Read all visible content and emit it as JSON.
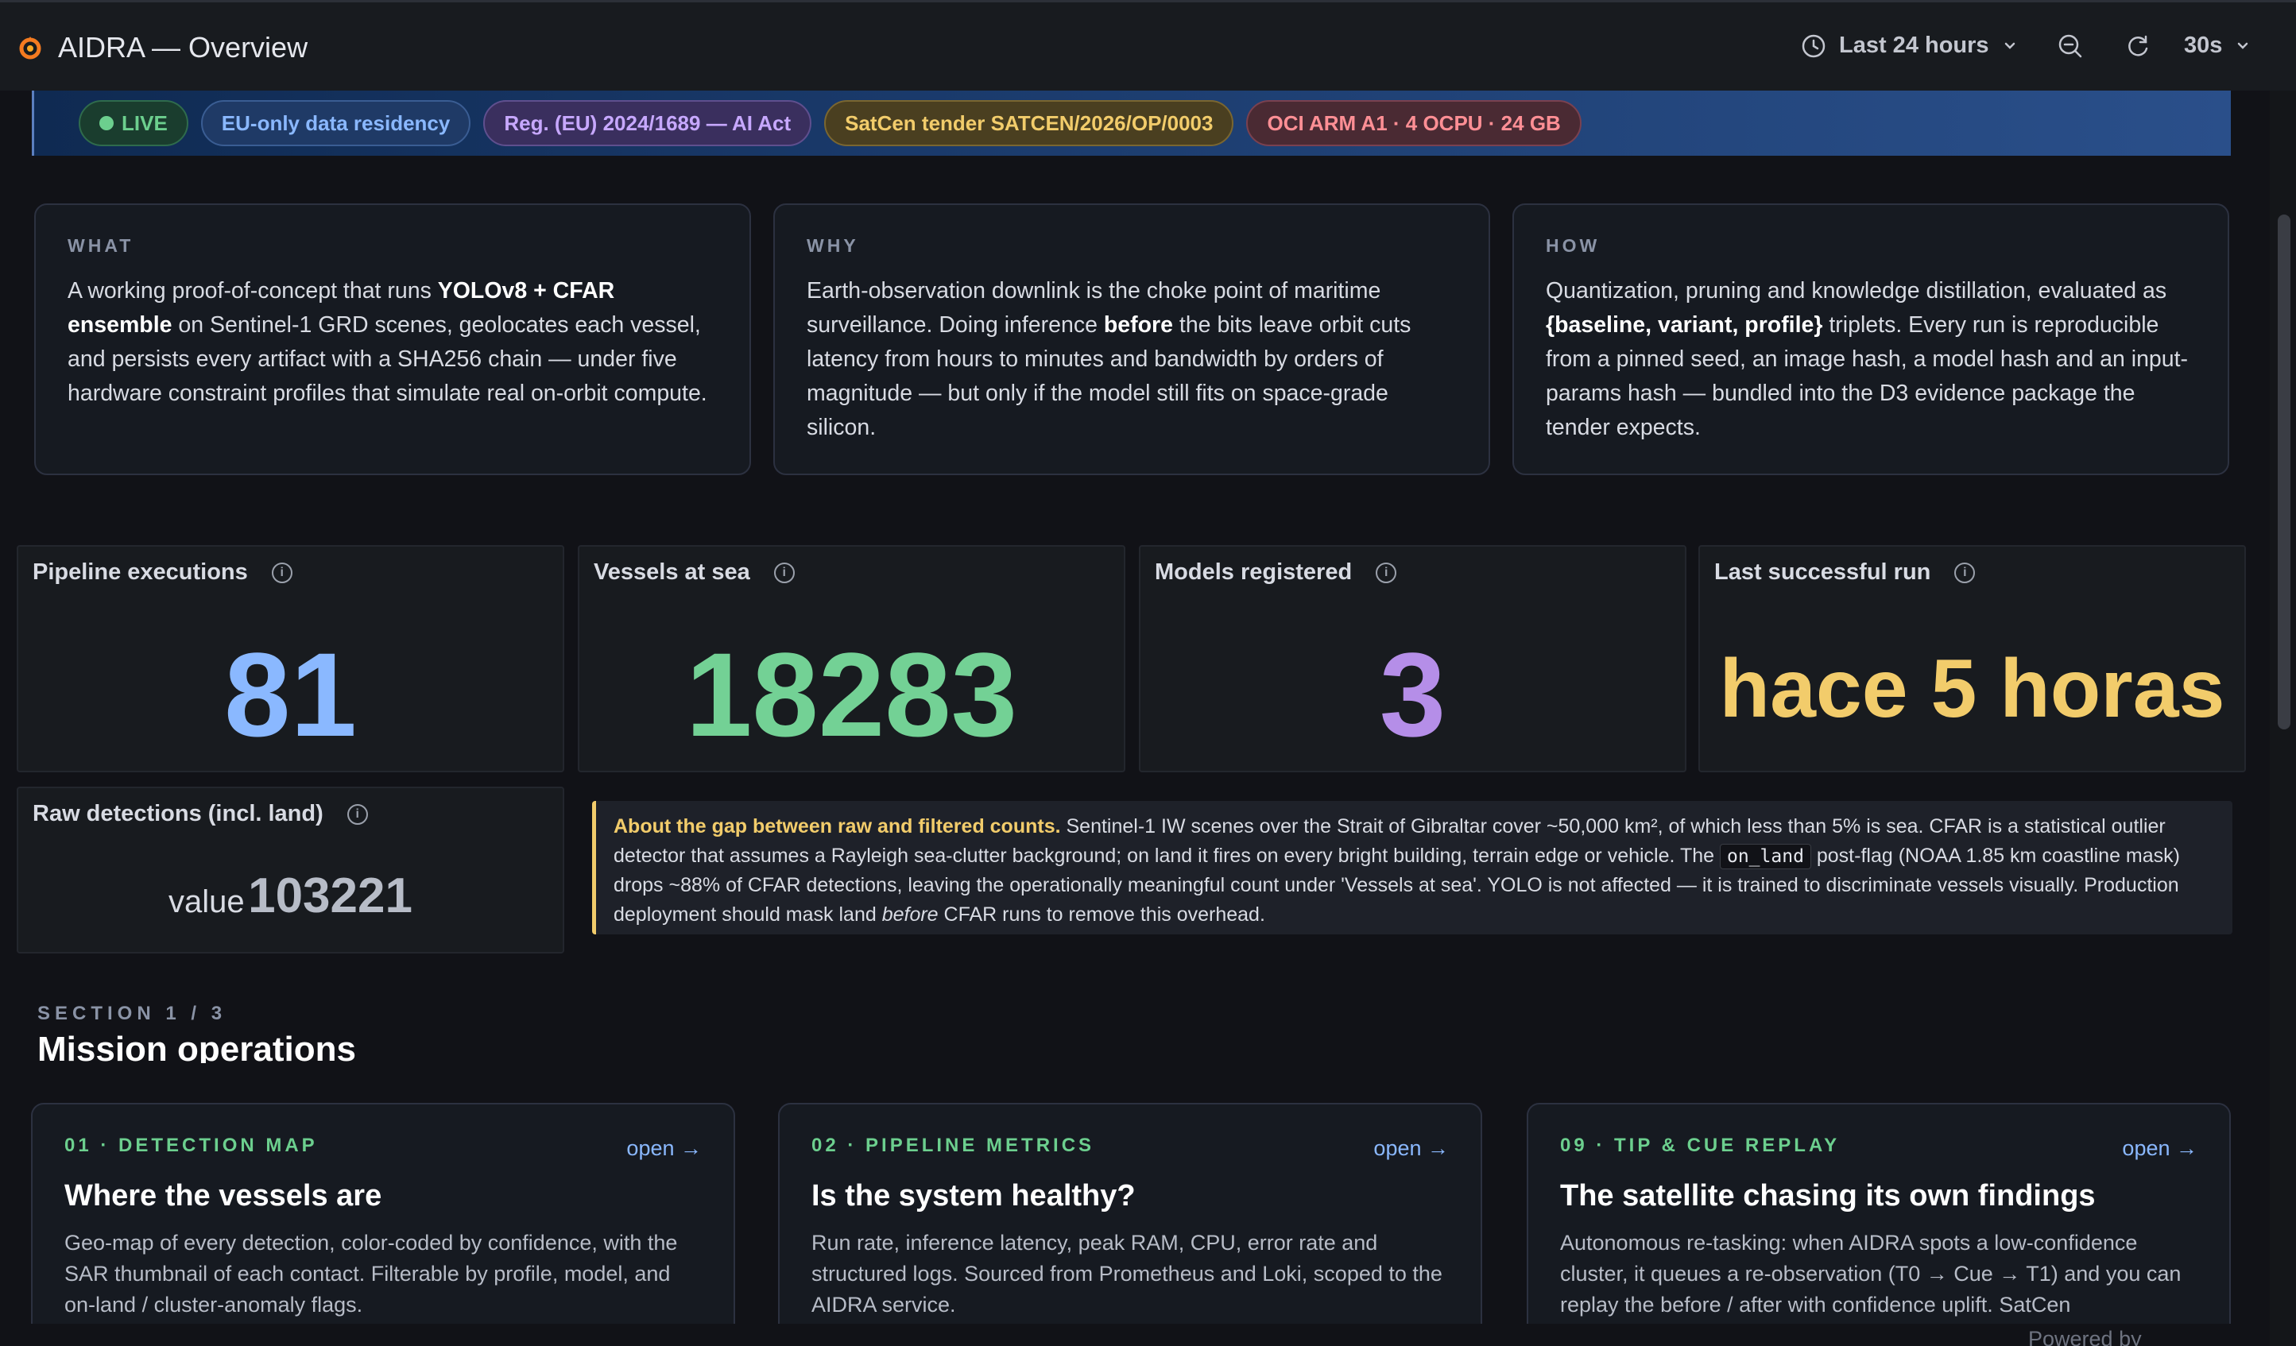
{
  "header": {
    "title": "AIDRA — Overview",
    "time_range": "Last 24 hours",
    "refresh_interval": "30s"
  },
  "banner": {
    "live": "LIVE",
    "eu": "EU-only data residency",
    "reg": "Reg. (EU) 2024/1689 — AI Act",
    "tender": "SatCen tender SATCEN/2026/OP/0003",
    "oci": "OCI ARM A1 · 4 OCPU · 24 GB"
  },
  "info_cards": [
    {
      "kicker": "WHAT",
      "pre": "A working proof-of-concept that runs ",
      "bold": "YOLOv8 + CFAR ensemble",
      "post": " on Sentinel-1 GRD scenes, geolocates each vessel, and persists every artifact with a SHA256 chain — under five hardware constraint profiles that simulate real on-orbit compute."
    },
    {
      "kicker": "WHY",
      "pre": "Earth-observation downlink is the choke point of maritime surveillance. Doing inference ",
      "bold": "before",
      "post": " the bits leave orbit cuts latency from hours to minutes and bandwidth by orders of magnitude — but only if the model still fits on space-grade silicon."
    },
    {
      "kicker": "HOW",
      "pre": "Quantization, pruning and knowledge distillation, evaluated as ",
      "bold": "{baseline, variant, profile}",
      "post": " triplets. Every run is reproducible from a pinned seed, an image hash, a model hash and an input-params hash — bundled into the D3 evidence package the tender expects."
    }
  ],
  "stats": {
    "pipeline_label": "Pipeline executions",
    "pipeline_value": "81",
    "vessels_label": "Vessels at sea",
    "vessels_value": "18283",
    "models_label": "Models registered",
    "models_value": "3",
    "lastrun_label": "Last successful run",
    "lastrun_value": "hace 5 horas",
    "raw_label": "Raw detections (incl. land)",
    "raw_prefix": "value",
    "raw_value": "103221"
  },
  "colors": {
    "blue": "#8ab8ff",
    "green": "#73d195",
    "purple": "#b58ee8",
    "yellow": "#f2cc6b",
    "grey": "#b7bcc7"
  },
  "gap_note": {
    "highlight": "About the gap between raw and filtered counts.",
    "part1": " Sentinel-1 IW scenes over the Strait of Gibraltar cover ~50,000 km², of which less than 5% is sea. CFAR is a statistical outlier detector that assumes a Rayleigh sea-clutter background; on land it fires on every bright building, terrain edge or vehicle. The ",
    "code": "on_land",
    "part2": " post-flag (NOAA 1.85 km coastline mask) drops ~88% of CFAR detections, leaving the operationally meaningful count under 'Vessels at sea'. YOLO is not affected — it is trained to discriminate vessels visually. Production deployment should mask land ",
    "italic": "before",
    "part3": " CFAR runs to remove this overhead."
  },
  "section": {
    "kicker": "SECTION 1 / 3",
    "title": "Mission operations"
  },
  "nav_cards": [
    {
      "kicker": "01 · DETECTION MAP",
      "open": "open →",
      "title": "Where the vessels are",
      "desc": "Geo-map of every detection, color-coded by confidence, with the SAR thumbnail of each contact. Filterable by profile, model, and on-land / cluster-anomaly flags."
    },
    {
      "kicker": "02 · PIPELINE METRICS",
      "open": "open →",
      "title": "Is the system healthy?",
      "desc": "Run rate, inference latency, peak RAM, CPU, error rate and structured logs. Sourced from Prometheus and Loki, scoped to the AIDRA service."
    },
    {
      "kicker": "09 · TIP & CUE REPLAY",
      "open": "open →",
      "title": "The satellite chasing its own findings",
      "desc": "Autonomous re-tasking: when AIDRA spots a low-confidence cluster, it queues a re-observation (T0 → Cue → T1) and you can replay the before / after with confidence uplift. SatCen"
    }
  ],
  "footer": {
    "powered": "Powered by"
  }
}
